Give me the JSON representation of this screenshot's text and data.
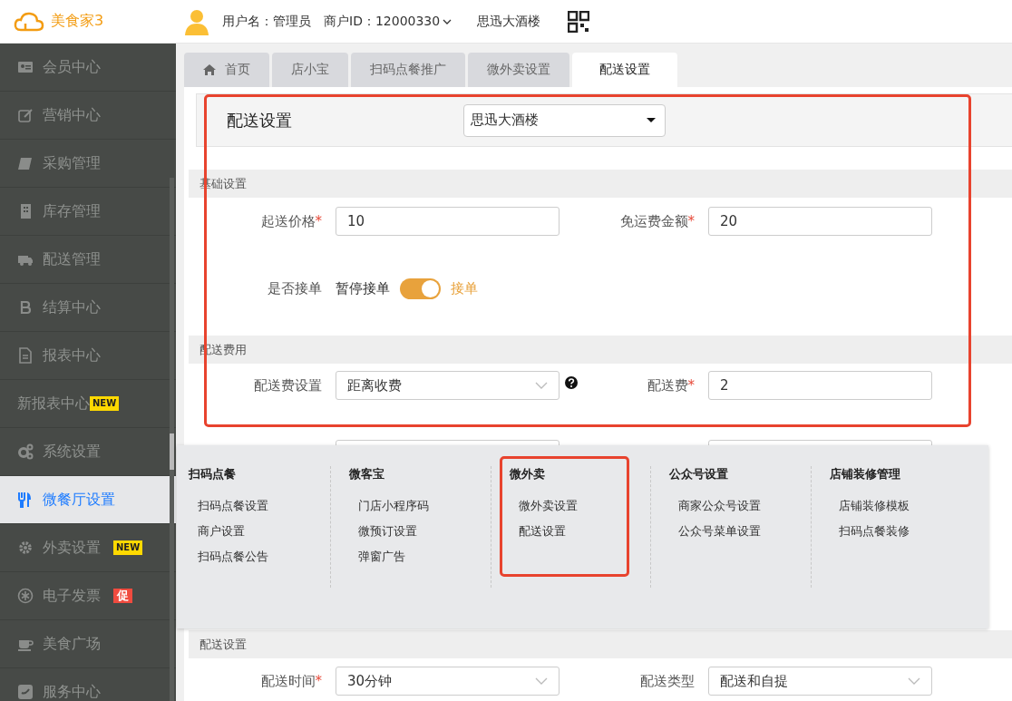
{
  "header": {
    "logo": "美食家3",
    "user": "用户名：管理员",
    "merchant": "商户ID：12000330",
    "store": "思迅大酒楼"
  },
  "sidebar": {
    "items": [
      {
        "label": "会员中心",
        "selected": false
      },
      {
        "label": "营销中心",
        "selected": false
      },
      {
        "label": "采购管理",
        "selected": false
      },
      {
        "label": "库存管理",
        "selected": false
      },
      {
        "label": "配送管理",
        "selected": false
      },
      {
        "label": "结算中心",
        "selected": false
      },
      {
        "label": "报表中心",
        "selected": false
      },
      {
        "label": "新报表中心",
        "selected": false,
        "badge": {
          "text": "NEW",
          "kind": "new"
        }
      },
      {
        "label": "系统设置",
        "selected": false
      },
      {
        "label": "微餐厅设置",
        "selected": true
      },
      {
        "label": "外卖设置",
        "selected": false,
        "badge": {
          "text": "NEW",
          "kind": "new"
        }
      },
      {
        "label": "电子发票",
        "selected": false,
        "badge": {
          "text": "促",
          "kind": "promo"
        }
      },
      {
        "label": "美食广场",
        "selected": false
      },
      {
        "label": "服务中心",
        "selected": false
      }
    ]
  },
  "tabs": [
    {
      "label": "首页",
      "selected": false
    },
    {
      "label": "店小宝",
      "selected": false
    },
    {
      "label": "扫码点餐推广",
      "selected": false
    },
    {
      "label": "微外卖设置",
      "selected": false
    },
    {
      "label": "配送设置",
      "selected": true
    }
  ],
  "page_header": {
    "title": "配送设置",
    "store_select": "思迅大酒楼"
  },
  "sections": [
    {
      "title": "基础设置",
      "rows": [
        [
          {
            "kind": "input",
            "label": "起送价格",
            "required_mark": "*",
            "value": "10"
          },
          {
            "kind": "input",
            "label": "免运费金额",
            "required_mark": "*",
            "value": "20"
          }
        ],
        [
          {
            "kind": "toggle",
            "label": "是否接单",
            "off_label": "暂停接单",
            "on_label": "接单",
            "on": true
          }
        ]
      ]
    },
    {
      "title": "配送费用",
      "rows": [
        [
          {
            "kind": "select",
            "label": "配送费设置",
            "value": "距离收费",
            "help": true
          },
          {
            "kind": "input",
            "label": "配送费",
            "required_mark": "*",
            "value": "2"
          }
        ],
        [
          {
            "kind": "input"
          },
          {
            "kind": "input"
          }
        ]
      ]
    },
    {
      "title": "配送设置",
      "rows": [
        [
          {
            "kind": "select",
            "label": "配送时间",
            "required_mark": "*",
            "value": "30分钟"
          },
          {
            "kind": "select",
            "label": "配送类型",
            "value": "配送和自提"
          }
        ]
      ]
    }
  ],
  "menu": {
    "columns": [
      {
        "title": "扫码点餐",
        "items": [
          "扫码点餐设置",
          "商户设置",
          "扫码点餐公告"
        ]
      },
      {
        "title": "微客宝",
        "items": [
          "门店小程序码",
          "微预订设置",
          "弹窗广告"
        ]
      },
      {
        "title": "微外卖",
        "items": [
          "微外卖设置",
          "配送设置"
        ]
      },
      {
        "title": "公众号设置",
        "items": [
          "商家公众号设置",
          "公众号菜单设置"
        ]
      },
      {
        "title": "店铺装修管理",
        "items": [
          "店铺装修模板",
          "扫码点餐装修"
        ]
      }
    ]
  }
}
